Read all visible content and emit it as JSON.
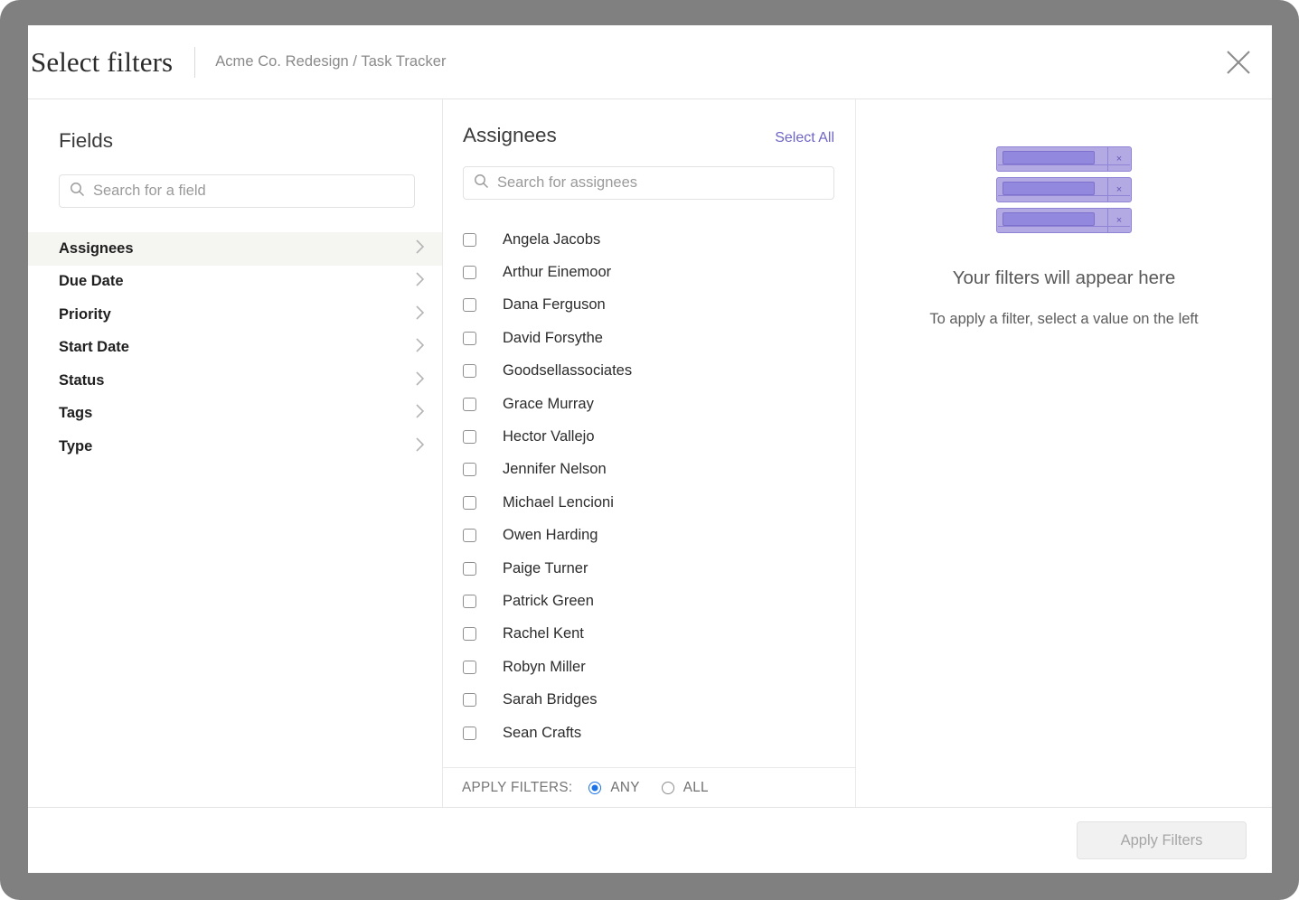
{
  "dialog": {
    "title": "Select filters",
    "breadcrumb": "Acme Co. Redesign / Task Tracker",
    "close_icon": "close-icon"
  },
  "fields_panel": {
    "heading": "Fields",
    "search": {
      "placeholder": "Search for a field",
      "value": "",
      "icon": "search-icon"
    },
    "items": [
      {
        "label": "Assignees",
        "active": true,
        "chevron": "chevron-right-icon"
      },
      {
        "label": "Due Date",
        "active": false,
        "chevron": "chevron-right-icon"
      },
      {
        "label": "Priority",
        "active": false,
        "chevron": "chevron-right-icon"
      },
      {
        "label": "Start Date",
        "active": false,
        "chevron": "chevron-right-icon"
      },
      {
        "label": "Status",
        "active": false,
        "chevron": "chevron-right-icon"
      },
      {
        "label": "Tags",
        "active": false,
        "chevron": "chevron-right-icon"
      },
      {
        "label": "Type",
        "active": false,
        "chevron": "chevron-right-icon"
      }
    ]
  },
  "values_panel": {
    "heading": "Assignees",
    "select_all_label": "Select All",
    "select_all_color": "#6f66c4",
    "search": {
      "placeholder": "Search for assignees",
      "value": "",
      "icon": "search-icon"
    },
    "options": [
      {
        "label": "Angela Jacobs",
        "checked": false
      },
      {
        "label": "Arthur Einemoor",
        "checked": false
      },
      {
        "label": "Dana Ferguson",
        "checked": false
      },
      {
        "label": "David Forsythe",
        "checked": false
      },
      {
        "label": "Goodsellassociates",
        "checked": false
      },
      {
        "label": "Grace Murray",
        "checked": false
      },
      {
        "label": "Hector Vallejo",
        "checked": false
      },
      {
        "label": "Jennifer Nelson",
        "checked": false
      },
      {
        "label": "Michael Lencioni",
        "checked": false
      },
      {
        "label": "Owen Harding",
        "checked": false
      },
      {
        "label": "Paige Turner",
        "checked": false
      },
      {
        "label": "Patrick Green",
        "checked": false
      },
      {
        "label": "Rachel Kent",
        "checked": false
      },
      {
        "label": "Robyn Miller",
        "checked": false
      },
      {
        "label": "Sarah Bridges",
        "checked": false
      },
      {
        "label": "Sean Crafts",
        "checked": false
      }
    ],
    "apply_mode": {
      "label": "APPLY FILTERS:",
      "options": [
        {
          "label": "ANY",
          "selected": true
        },
        {
          "label": "ALL",
          "selected": false
        }
      ],
      "selected_color": "#1a73e8"
    }
  },
  "preview_panel": {
    "title": "Your filters will appear here",
    "subtitle": "To apply a filter, select a value on the left",
    "placeholder_chips": [
      {
        "remove_icon": "close-icon",
        "remove_label": "×"
      },
      {
        "remove_icon": "close-icon",
        "remove_label": "×"
      },
      {
        "remove_icon": "close-icon",
        "remove_label": "×"
      }
    ],
    "chip_color": "#b3aae4",
    "chip_inner_color": "#9288dd"
  },
  "footer": {
    "apply_button_label": "Apply Filters",
    "apply_button_disabled": true
  }
}
